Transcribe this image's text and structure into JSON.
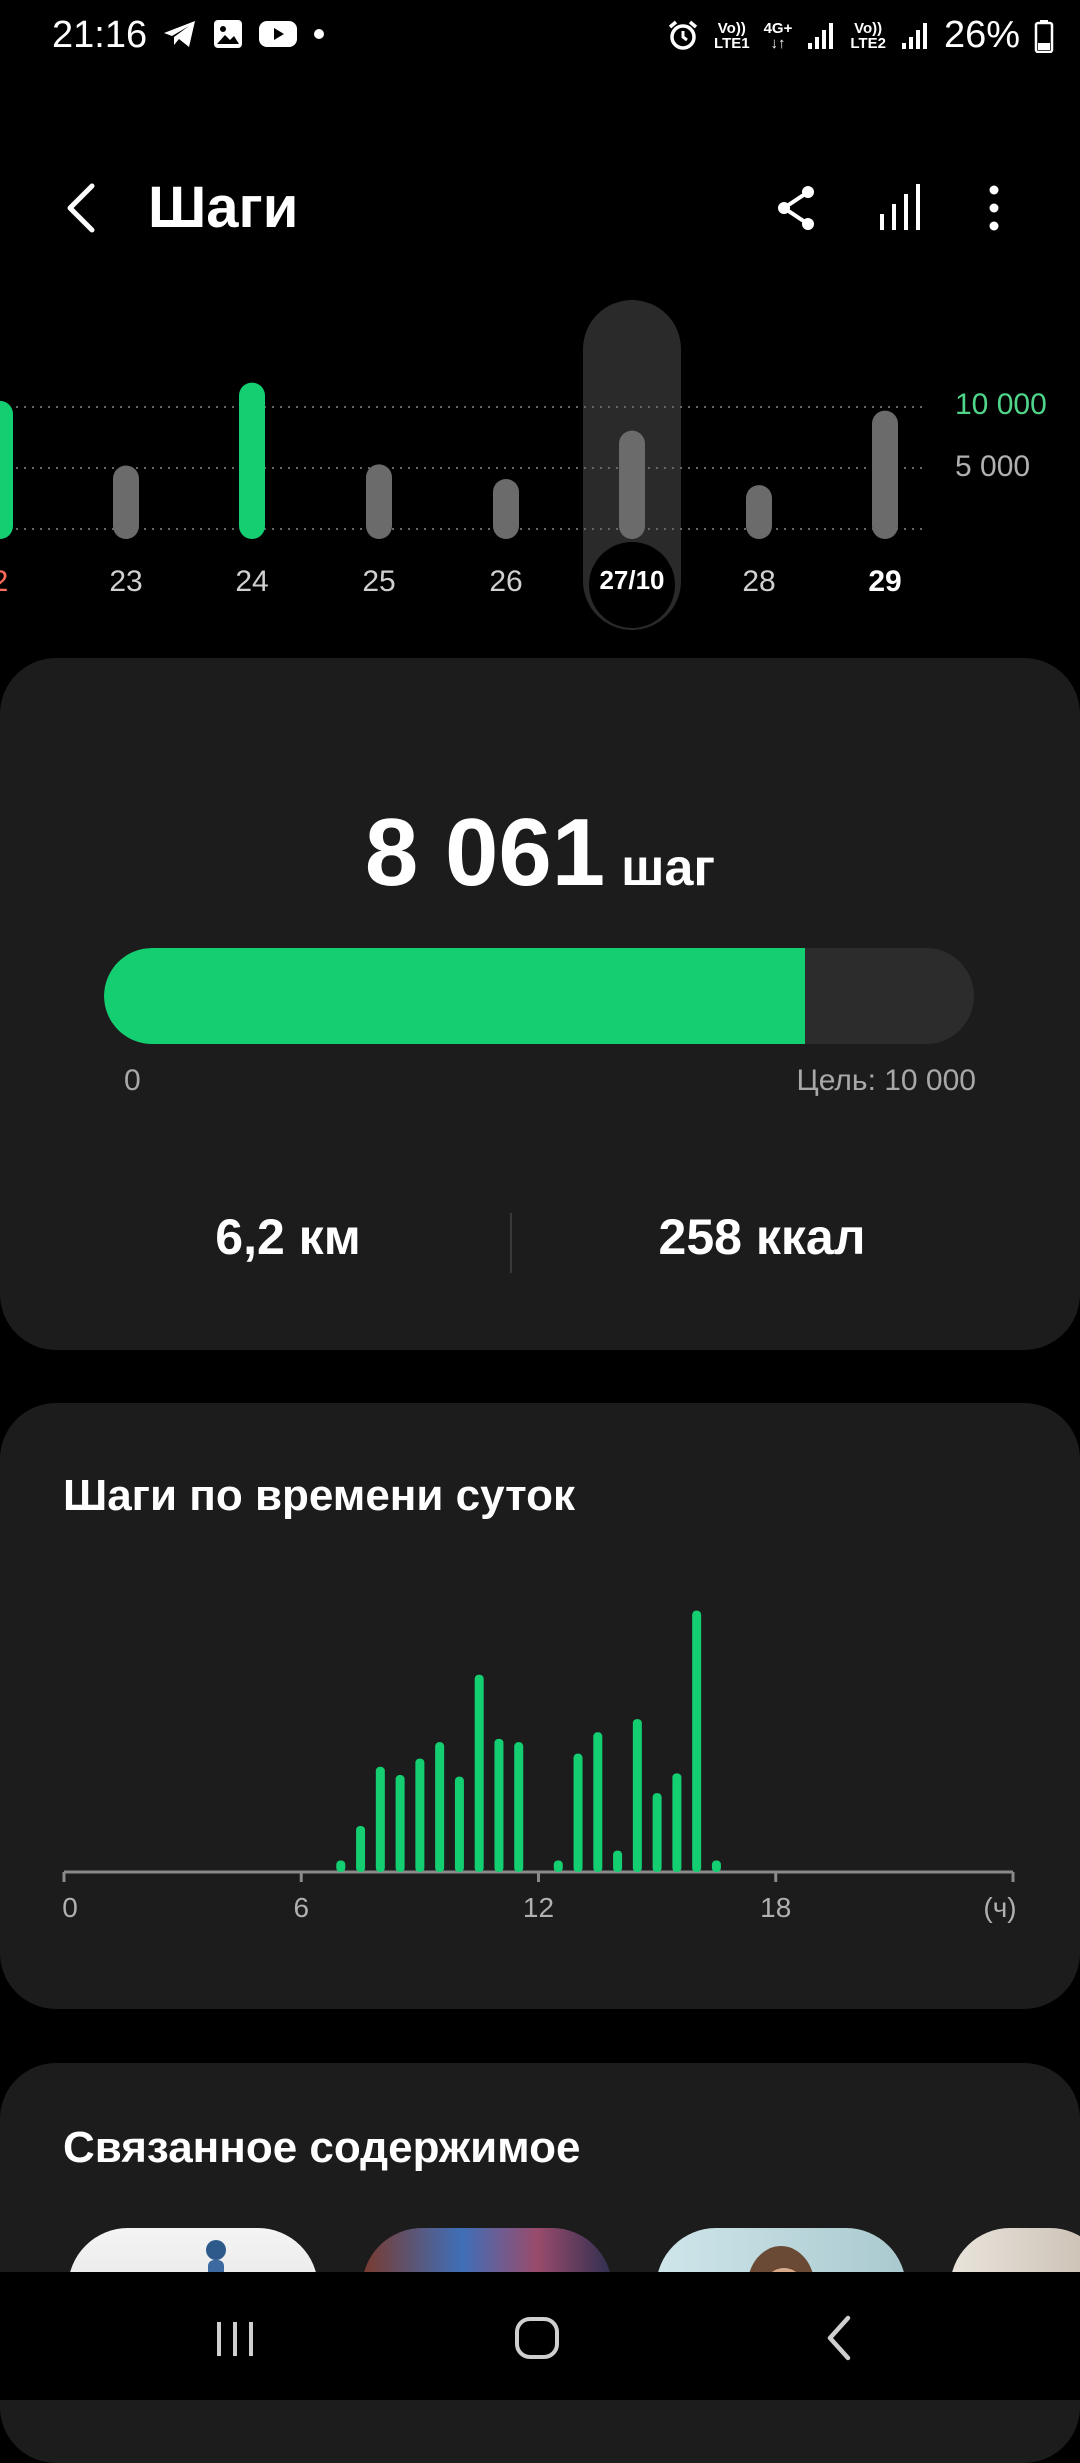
{
  "status_bar": {
    "time": "21:16",
    "battery": "26%",
    "sim1_top": "Vo))",
    "sim1_bottom": "LTE1",
    "net_top": "4G+",
    "net_bottom": "↓↑",
    "sim2_top": "Vo))",
    "sim2_bottom": "LTE2",
    "icons_left": [
      "telegram-icon",
      "gallery-icon",
      "youtube-icon",
      "dot-icon"
    ],
    "icons_right": [
      "alarm-icon",
      "signal-icon",
      "battery-icon"
    ]
  },
  "header": {
    "title": "Шаги",
    "icons": [
      "back-arrow-icon",
      "share-icon",
      "bar-chart-icon",
      "more-vert-icon"
    ]
  },
  "week_chart": {
    "goal_label": "10 000",
    "mid_label": "5 000",
    "goal": 10000,
    "days": [
      {
        "label": "2",
        "steps": 10500,
        "goal_met": true,
        "color": "#ff6b5b"
      },
      {
        "label": "23",
        "steps": 5200,
        "goal_met": false
      },
      {
        "label": "24",
        "steps": 12000,
        "goal_met": true
      },
      {
        "label": "25",
        "steps": 5300,
        "goal_met": false
      },
      {
        "label": "26",
        "steps": 4100,
        "goal_met": false
      },
      {
        "label": "27/10",
        "steps": 8061,
        "goal_met": false,
        "selected": true
      },
      {
        "label": "28",
        "steps": 3600,
        "goal_met": false
      },
      {
        "label": "29",
        "steps": 9700,
        "goal_met": false,
        "today": true
      }
    ]
  },
  "summary": {
    "steps_value": "8 061",
    "steps_unit": "шаг",
    "progress_fraction": 0.8061,
    "progress_min": "0",
    "progress_goal": "Цель: 10 000",
    "distance": "6,2 км",
    "calories": "258 ккал"
  },
  "hourly": {
    "title": "Шаги по времени суток",
    "axis_labels": [
      "0",
      "6",
      "12",
      "18",
      "(ч)"
    ]
  },
  "chart_data": {
    "type": "bar",
    "title": "Шаги по времени суток",
    "xlabel": "(ч)",
    "x_ticks": [
      0,
      6,
      12,
      18
    ],
    "xlim": [
      0,
      24
    ],
    "x": [
      7.0,
      7.5,
      8.0,
      8.5,
      9.0,
      9.5,
      10.0,
      10.5,
      11.0,
      11.5,
      12.5,
      13.0,
      13.5,
      14.0,
      14.5,
      15.0,
      15.5,
      16.0,
      16.5
    ],
    "values": [
      70,
      280,
      640,
      590,
      690,
      790,
      580,
      1200,
      810,
      790,
      70,
      720,
      850,
      130,
      930,
      480,
      600,
      1590,
      70
    ],
    "ylim": [
      0,
      1600
    ],
    "color": "#13cf72"
  },
  "related": {
    "title": "Связанное содержимое"
  },
  "nav": {
    "icons": [
      "recents-icon",
      "home-icon",
      "back-icon"
    ]
  },
  "colors": {
    "accent": "#13cf72",
    "bar_gray": "#6b6b6b",
    "card_bg": "#1c1c1c",
    "goal_text": "#4fd48a"
  }
}
